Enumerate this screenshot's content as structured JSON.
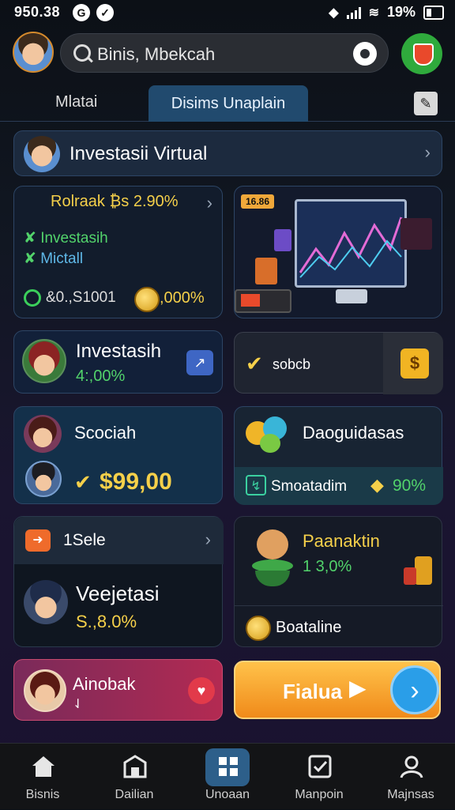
{
  "status_bar": {
    "time": "950.38",
    "battery": "19%"
  },
  "search": {
    "placeholder": "Binis, Mbekcah"
  },
  "tabs": {
    "tab1": "Mlatai",
    "tab2": "Disims Unaplain"
  },
  "header": {
    "title": "Investasii Virtual"
  },
  "summary_card": {
    "title": "Rolraak ₿s 2.90%",
    "items": [
      "Investasih",
      "Mictall"
    ],
    "left_value": "&0.,S1001",
    "coin_value": ",000%"
  },
  "chart_illustration": {
    "badge": "16.86"
  },
  "invest_card": {
    "title": "Investasih",
    "value": "4:,00%"
  },
  "sobcb_card": {
    "label": "sobcb"
  },
  "social_card": {
    "title": "Scociah",
    "amount": "$99,00"
  },
  "dao_card": {
    "title": "Daoguidasas",
    "sub_label": "Smoatadim",
    "sub_value": "90%"
  },
  "sale_card": {
    "title": "1Sele",
    "name": "Veejetasi",
    "value": "S.,8.0%"
  },
  "panaktin_card": {
    "title": "Paanaktin",
    "value": "1 3,0%",
    "footer": "Boataline"
  },
  "alert_card": {
    "title": "Ainobak",
    "sub": "⇃"
  },
  "cta_button": {
    "label": "Fialua"
  },
  "bottom_nav": [
    "Bisnis",
    "Dailian",
    "Unoaan",
    "Manpoin",
    "Majnsas"
  ],
  "colors": {
    "accent": "#214a6e",
    "gold": "#f5d04a",
    "green": "#52d36b",
    "cta": "#f7a72a"
  }
}
